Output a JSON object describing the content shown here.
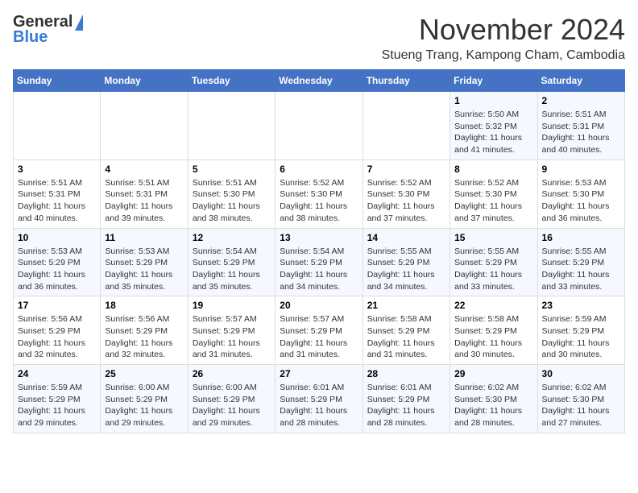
{
  "header": {
    "logo": {
      "line1": "General",
      "line2": "Blue"
    },
    "month": "November 2024",
    "location": "Stueng Trang, Kampong Cham, Cambodia"
  },
  "days_of_week": [
    "Sunday",
    "Monday",
    "Tuesday",
    "Wednesday",
    "Thursday",
    "Friday",
    "Saturday"
  ],
  "weeks": [
    [
      {
        "day": "",
        "info": ""
      },
      {
        "day": "",
        "info": ""
      },
      {
        "day": "",
        "info": ""
      },
      {
        "day": "",
        "info": ""
      },
      {
        "day": "",
        "info": ""
      },
      {
        "day": "1",
        "info": "Sunrise: 5:50 AM\nSunset: 5:32 PM\nDaylight: 11 hours and 41 minutes."
      },
      {
        "day": "2",
        "info": "Sunrise: 5:51 AM\nSunset: 5:31 PM\nDaylight: 11 hours and 40 minutes."
      }
    ],
    [
      {
        "day": "3",
        "info": "Sunrise: 5:51 AM\nSunset: 5:31 PM\nDaylight: 11 hours and 40 minutes."
      },
      {
        "day": "4",
        "info": "Sunrise: 5:51 AM\nSunset: 5:31 PM\nDaylight: 11 hours and 39 minutes."
      },
      {
        "day": "5",
        "info": "Sunrise: 5:51 AM\nSunset: 5:30 PM\nDaylight: 11 hours and 38 minutes."
      },
      {
        "day": "6",
        "info": "Sunrise: 5:52 AM\nSunset: 5:30 PM\nDaylight: 11 hours and 38 minutes."
      },
      {
        "day": "7",
        "info": "Sunrise: 5:52 AM\nSunset: 5:30 PM\nDaylight: 11 hours and 37 minutes."
      },
      {
        "day": "8",
        "info": "Sunrise: 5:52 AM\nSunset: 5:30 PM\nDaylight: 11 hours and 37 minutes."
      },
      {
        "day": "9",
        "info": "Sunrise: 5:53 AM\nSunset: 5:30 PM\nDaylight: 11 hours and 36 minutes."
      }
    ],
    [
      {
        "day": "10",
        "info": "Sunrise: 5:53 AM\nSunset: 5:29 PM\nDaylight: 11 hours and 36 minutes."
      },
      {
        "day": "11",
        "info": "Sunrise: 5:53 AM\nSunset: 5:29 PM\nDaylight: 11 hours and 35 minutes."
      },
      {
        "day": "12",
        "info": "Sunrise: 5:54 AM\nSunset: 5:29 PM\nDaylight: 11 hours and 35 minutes."
      },
      {
        "day": "13",
        "info": "Sunrise: 5:54 AM\nSunset: 5:29 PM\nDaylight: 11 hours and 34 minutes."
      },
      {
        "day": "14",
        "info": "Sunrise: 5:55 AM\nSunset: 5:29 PM\nDaylight: 11 hours and 34 minutes."
      },
      {
        "day": "15",
        "info": "Sunrise: 5:55 AM\nSunset: 5:29 PM\nDaylight: 11 hours and 33 minutes."
      },
      {
        "day": "16",
        "info": "Sunrise: 5:55 AM\nSunset: 5:29 PM\nDaylight: 11 hours and 33 minutes."
      }
    ],
    [
      {
        "day": "17",
        "info": "Sunrise: 5:56 AM\nSunset: 5:29 PM\nDaylight: 11 hours and 32 minutes."
      },
      {
        "day": "18",
        "info": "Sunrise: 5:56 AM\nSunset: 5:29 PM\nDaylight: 11 hours and 32 minutes."
      },
      {
        "day": "19",
        "info": "Sunrise: 5:57 AM\nSunset: 5:29 PM\nDaylight: 11 hours and 31 minutes."
      },
      {
        "day": "20",
        "info": "Sunrise: 5:57 AM\nSunset: 5:29 PM\nDaylight: 11 hours and 31 minutes."
      },
      {
        "day": "21",
        "info": "Sunrise: 5:58 AM\nSunset: 5:29 PM\nDaylight: 11 hours and 31 minutes."
      },
      {
        "day": "22",
        "info": "Sunrise: 5:58 AM\nSunset: 5:29 PM\nDaylight: 11 hours and 30 minutes."
      },
      {
        "day": "23",
        "info": "Sunrise: 5:59 AM\nSunset: 5:29 PM\nDaylight: 11 hours and 30 minutes."
      }
    ],
    [
      {
        "day": "24",
        "info": "Sunrise: 5:59 AM\nSunset: 5:29 PM\nDaylight: 11 hours and 29 minutes."
      },
      {
        "day": "25",
        "info": "Sunrise: 6:00 AM\nSunset: 5:29 PM\nDaylight: 11 hours and 29 minutes."
      },
      {
        "day": "26",
        "info": "Sunrise: 6:00 AM\nSunset: 5:29 PM\nDaylight: 11 hours and 29 minutes."
      },
      {
        "day": "27",
        "info": "Sunrise: 6:01 AM\nSunset: 5:29 PM\nDaylight: 11 hours and 28 minutes."
      },
      {
        "day": "28",
        "info": "Sunrise: 6:01 AM\nSunset: 5:29 PM\nDaylight: 11 hours and 28 minutes."
      },
      {
        "day": "29",
        "info": "Sunrise: 6:02 AM\nSunset: 5:30 PM\nDaylight: 11 hours and 28 minutes."
      },
      {
        "day": "30",
        "info": "Sunrise: 6:02 AM\nSunset: 5:30 PM\nDaylight: 11 hours and 27 minutes."
      }
    ]
  ]
}
